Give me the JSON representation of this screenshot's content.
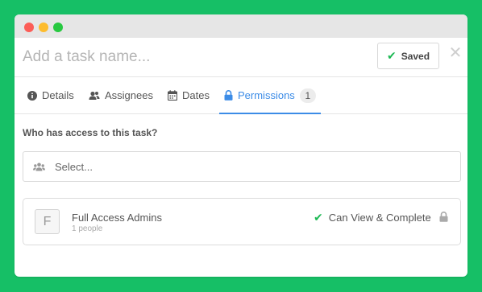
{
  "colors": {
    "background": "#16bf66",
    "accent": "#3c8ce7",
    "success": "#1db954"
  },
  "window": {
    "controls": [
      "close",
      "minimize",
      "maximize"
    ]
  },
  "header": {
    "task_placeholder": "Add a task name...",
    "saved_label": "Saved",
    "close_glyph": "✕"
  },
  "tabs": [
    {
      "label": "Details",
      "icon": "info-icon"
    },
    {
      "label": "Assignees",
      "icon": "users-icon"
    },
    {
      "label": "Dates",
      "icon": "calendar-icon"
    },
    {
      "label": "Permissions",
      "icon": "lock-icon",
      "badge": "1",
      "active": true
    }
  ],
  "permissions": {
    "question": "Who has access to this task?",
    "select_placeholder": "Select...",
    "entries": [
      {
        "initial": "F",
        "name": "Full Access Admins",
        "count": "1 people",
        "access": "Can View & Complete"
      }
    ]
  }
}
